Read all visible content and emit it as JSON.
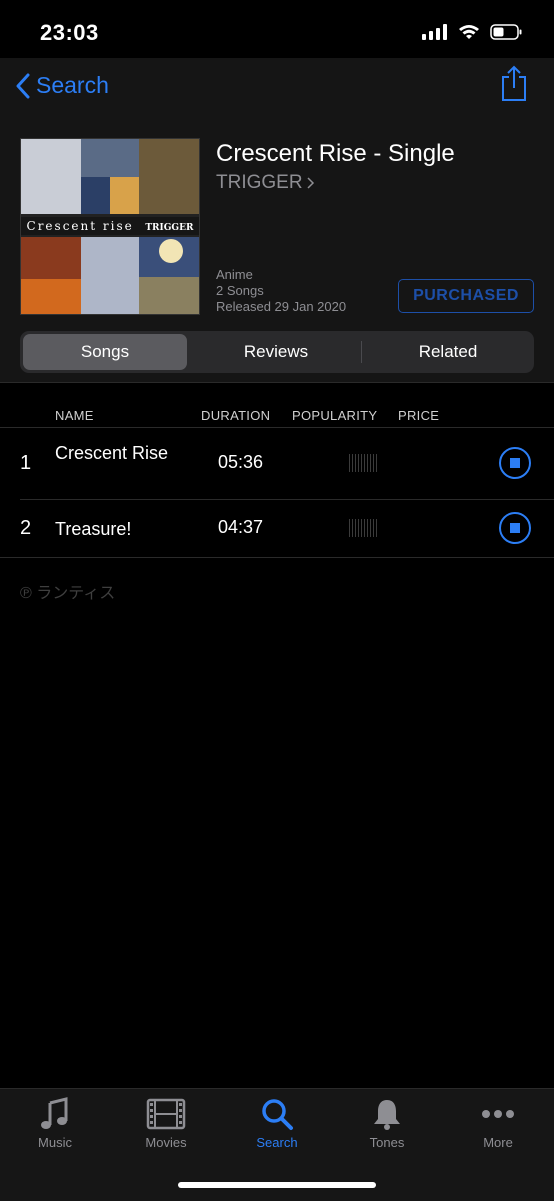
{
  "status_bar": {
    "time": "23:03"
  },
  "nav": {
    "back_label": "Search"
  },
  "album": {
    "artwork_text": "Crescent rise",
    "artwork_brand": "TRIGGER",
    "title": "Crescent Rise - Single",
    "artist": "TRIGGER",
    "genre": "Anime",
    "song_count": "2 Songs",
    "released": "Released 29 Jan 2020",
    "purchase_status": "PURCHASED"
  },
  "segments": [
    "Songs",
    "Reviews",
    "Related"
  ],
  "table": {
    "headers": [
      "NAME",
      "DURATION",
      "POPULARITY",
      "PRICE"
    ],
    "rows": [
      {
        "number": "1",
        "name": "Crescent Rise",
        "duration": "05:36"
      },
      {
        "number": "2",
        "name": "Treasure!",
        "duration": "04:37"
      }
    ]
  },
  "copyright": "℗ ランティス",
  "tabbar": {
    "items": [
      {
        "label": "Music",
        "icon": "music-note-icon"
      },
      {
        "label": "Movies",
        "icon": "film-icon"
      },
      {
        "label": "Search",
        "icon": "search-icon"
      },
      {
        "label": "Tones",
        "icon": "bell-icon"
      },
      {
        "label": "More",
        "icon": "ellipsis-icon"
      }
    ],
    "active": "Search"
  },
  "colors": {
    "accent": "#2c7ef5",
    "purchased": "#1d4fa8",
    "background": "#000000",
    "secondary_text": "#8e8e93"
  }
}
